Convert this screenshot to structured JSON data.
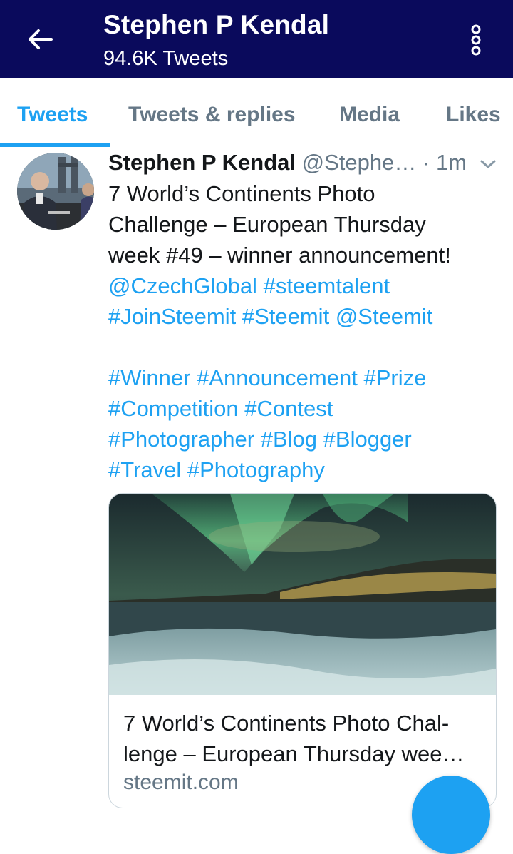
{
  "header": {
    "name": "Stephen P Kendal",
    "tweet_count": "94.6K Tweets"
  },
  "tabs": [
    {
      "label": "Tweets",
      "active": true
    },
    {
      "label": "Tweets & replies",
      "active": false
    },
    {
      "label": "Media",
      "active": false
    },
    {
      "label": "Likes",
      "active": false
    }
  ],
  "tweet": {
    "author_name": "Stephen P Kendal",
    "author_handle": "@Stephe…",
    "separator": "·",
    "time": "1m",
    "text_lines": [
      "7 World’s Continents Photo",
      "Challenge – European Thursday",
      "week #49 – winner announcement!"
    ],
    "links_line1": [
      "@CzechGlobal",
      "#steemtalent"
    ],
    "links_line2": [
      "#JoinSteemit",
      "#Steemit",
      "@Steemit"
    ],
    "hashtags_line1": [
      "#Winner",
      "#Announcement",
      "#Prize"
    ],
    "hashtags_line2": [
      "#Competition",
      "#Contest"
    ],
    "hashtags_line3": [
      "#Photographer",
      "#Blog",
      "#Blogger"
    ],
    "hashtags_line4": [
      "#Travel",
      "#Photography"
    ]
  },
  "card": {
    "title_line1": "7 World’s Continents Photo Chal-",
    "title_line2": "lenge – European Thursday wee…",
    "domain": "steemit.com"
  },
  "colors": {
    "topbar": "#0a0a5c",
    "accent": "#1da1f2",
    "secondary_text": "#657786"
  },
  "icons": {
    "back": "arrow-left-icon",
    "more": "more-vertical-icon",
    "caret": "chevron-down-icon"
  }
}
